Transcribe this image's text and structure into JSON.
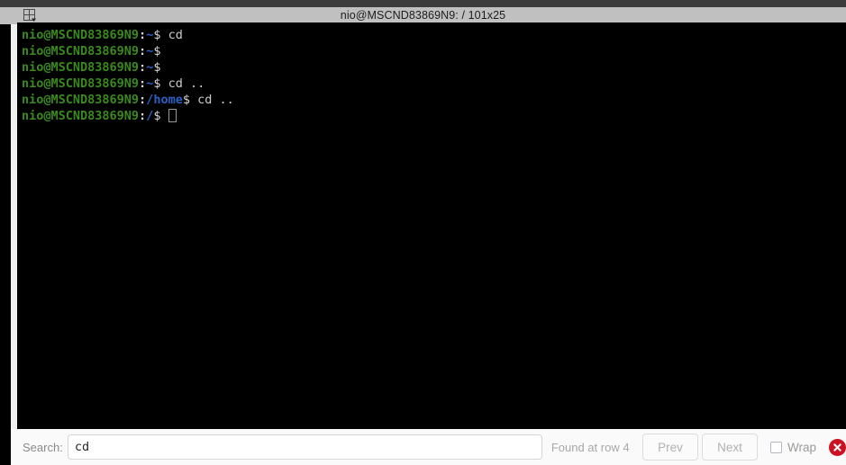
{
  "window": {
    "title": "nio@MSCND83869N9: / 101x25",
    "menu_icon": "window-layout-icon"
  },
  "terminal": {
    "lines": [
      {
        "prompt": "nio@MSCND83869N9",
        "colon": ":",
        "path": "~",
        "dollar": "$",
        "command": " cd",
        "cursor": false
      },
      {
        "prompt": "nio@MSCND83869N9",
        "colon": ":",
        "path": "~",
        "dollar": "$",
        "command": "",
        "cursor": false
      },
      {
        "prompt": "nio@MSCND83869N9",
        "colon": ":",
        "path": "~",
        "dollar": "$",
        "command": "",
        "cursor": false
      },
      {
        "prompt": "nio@MSCND83869N9",
        "colon": ":",
        "path": "~",
        "dollar": "$",
        "command": " cd ..",
        "cursor": false
      },
      {
        "prompt": "nio@MSCND83869N9",
        "colon": ":",
        "path": "/home",
        "dollar": "$",
        "command": " cd ..",
        "cursor": false
      },
      {
        "prompt": "nio@MSCND83869N9",
        "colon": ":",
        "path": "/",
        "dollar": "$",
        "command": " ",
        "cursor": true
      }
    ]
  },
  "search": {
    "label": "Search:",
    "value": "cd",
    "placeholder": "",
    "status": "Found at row 4",
    "prev_label": "Prev",
    "next_label": "Next",
    "wrap_label": "Wrap",
    "wrap_checked": false,
    "close_icon": "close-circle-icon"
  },
  "colors": {
    "terminal_bg": "#000000",
    "prompt_green": "#3a8a1e",
    "path_blue": "#2b61c4",
    "command_gray": "#cccccc",
    "titlebar_bg": "#c0c0c0",
    "searchbar_bg": "#fafafa",
    "close_red": "#cc1122"
  }
}
